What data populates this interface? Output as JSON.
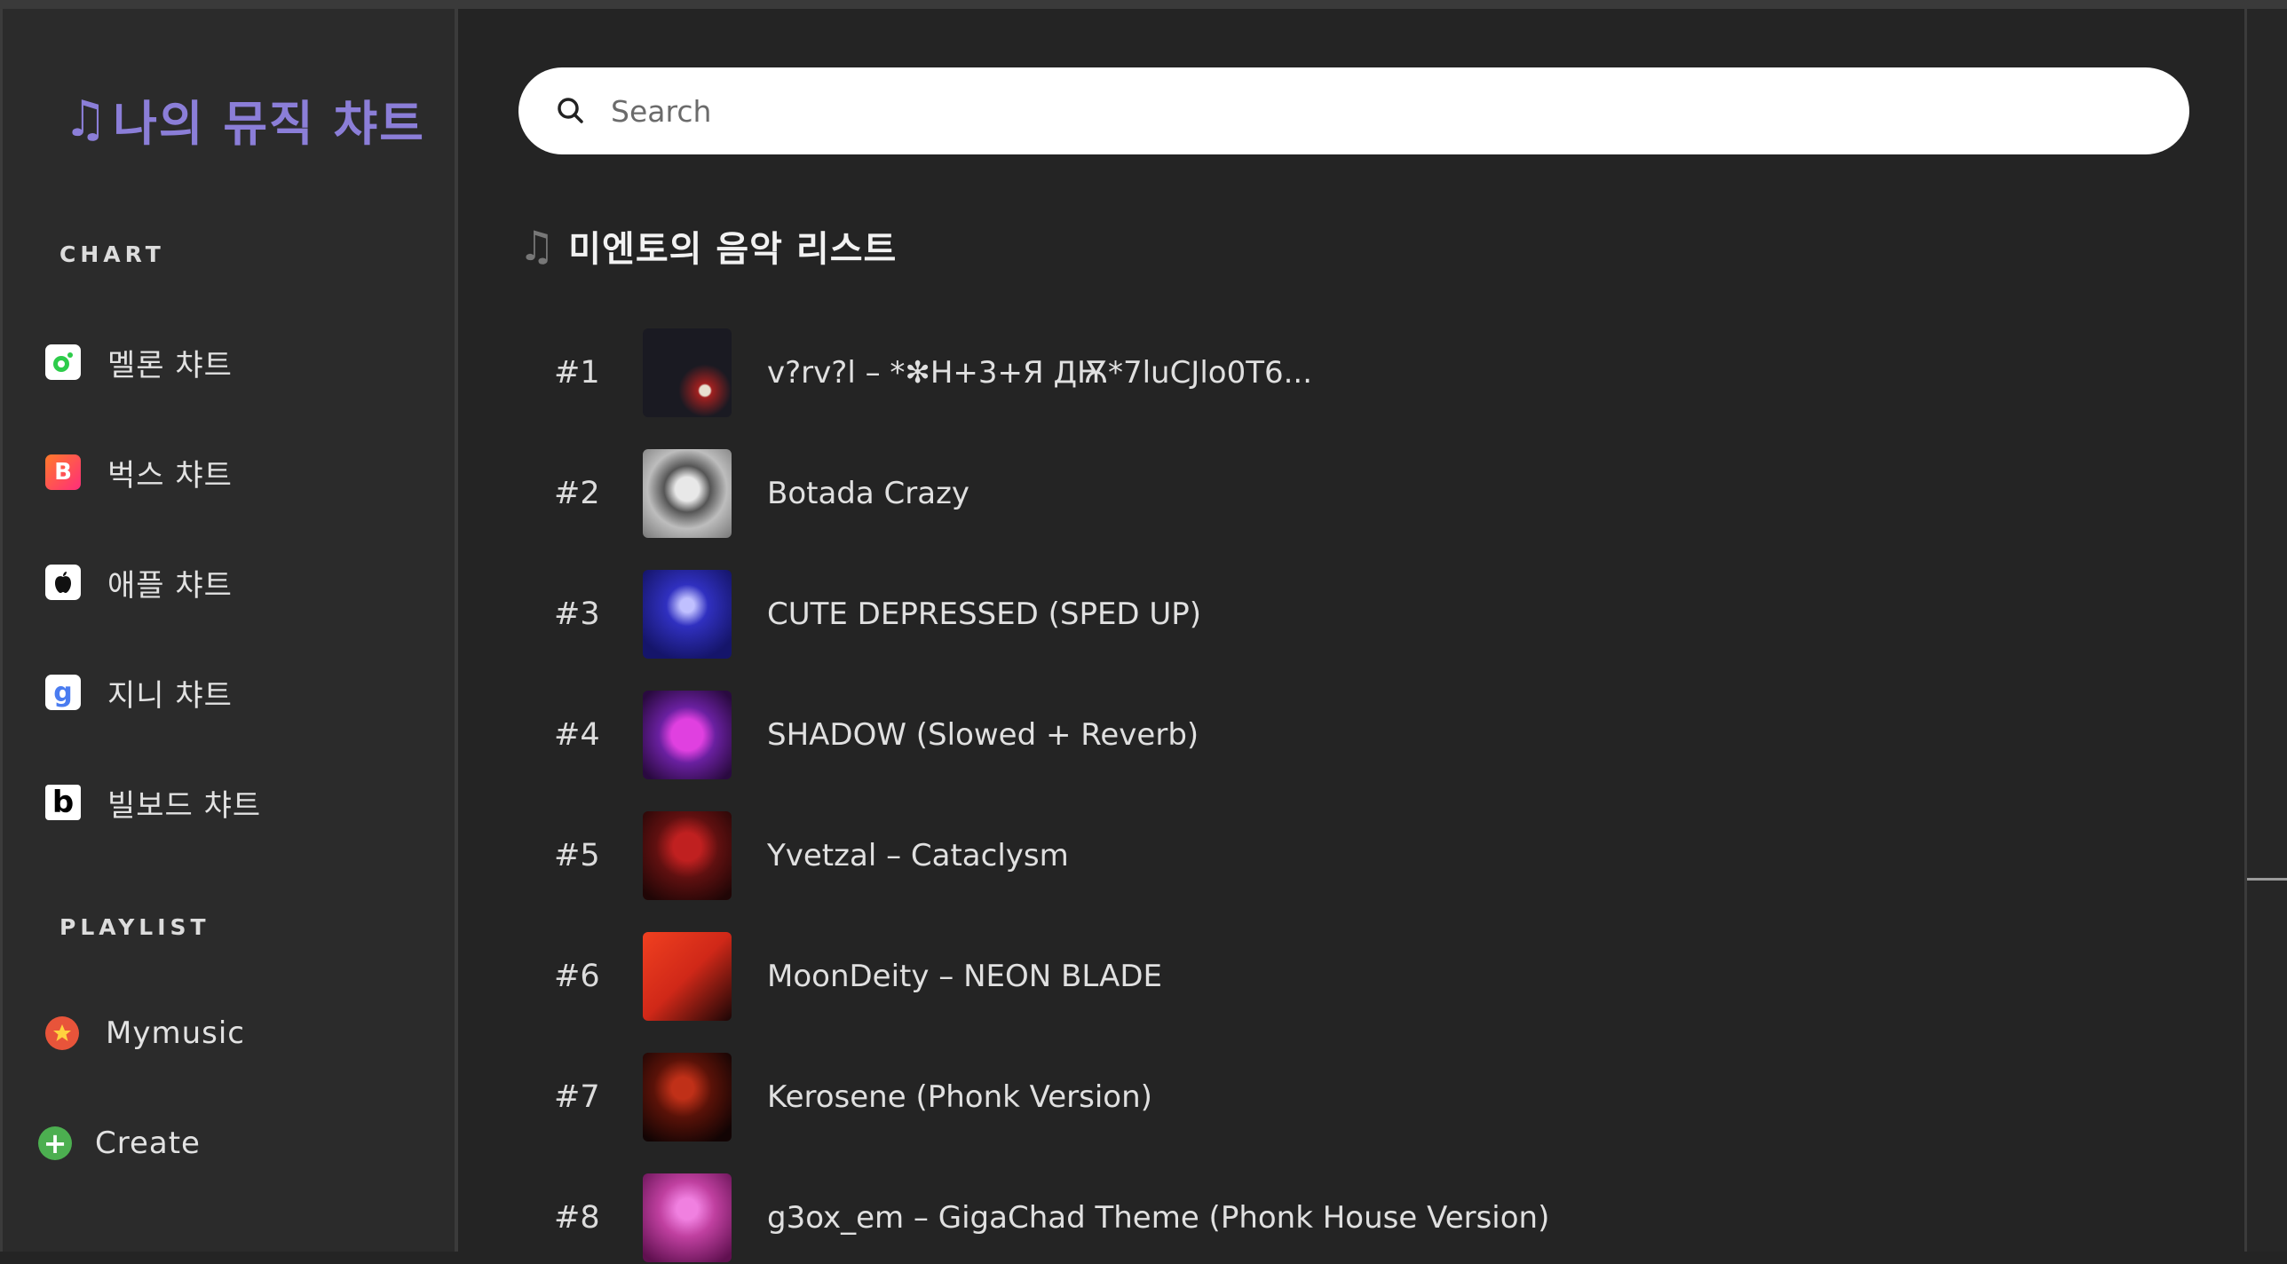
{
  "app": {
    "logo_note": "♫",
    "logo_text": "나의 뮤직 챠트"
  },
  "sidebar": {
    "chart_section": "CHART",
    "charts": [
      {
        "label": "멜론 챠트",
        "icon": "melon-icon",
        "color": "#ffffff"
      },
      {
        "label": "벅스 챠트",
        "icon": "bugs-icon",
        "color": "#ff3b6b"
      },
      {
        "label": "애플 챠트",
        "icon": "apple-icon",
        "color": "#ffffff"
      },
      {
        "label": "지니 챠트",
        "icon": "genie-icon",
        "color": "#ffffff"
      },
      {
        "label": "빌보드 챠트",
        "icon": "billboard-icon",
        "color": "#ffffff"
      }
    ],
    "playlist_section": "PLAYLIST",
    "playlists": [
      {
        "label": "Mymusic",
        "icon": "star-icon",
        "color": "#e8543a"
      },
      {
        "label": "Create",
        "icon": "plus-icon",
        "color": "#4caf50"
      }
    ]
  },
  "search": {
    "placeholder": "Search"
  },
  "list": {
    "note": "♫",
    "title": "미엔토의 음악 리스트",
    "tracks": [
      {
        "rank": "#1",
        "title": "v?rv?l – *✻H+3+Я ДѬ*7luCJlo0T6...",
        "thumb": "#1a1a22"
      },
      {
        "rank": "#2",
        "title": "Botada Crazy",
        "thumb": "#9a9a9a"
      },
      {
        "rank": "#3",
        "title": "CUTE DEPRESSED (SPED UP)",
        "thumb": "#2a2a9c"
      },
      {
        "rank": "#4",
        "title": "SHADOW (Slowed + Reverb)",
        "thumb": "#7a2a9a"
      },
      {
        "rank": "#5",
        "title": "Yvetzal – Cataclysm",
        "thumb": "#5a1010"
      },
      {
        "rank": "#6",
        "title": "MoonDeity – NEON BLADE",
        "thumb": "#d83020"
      },
      {
        "rank": "#7",
        "title": "Kerosene (Phonk Version)",
        "thumb": "#3a0c08"
      },
      {
        "rank": "#8",
        "title": "g3ox_em – GigaChad Theme (Phonk House Version)",
        "thumb": "#c040a0"
      }
    ]
  }
}
